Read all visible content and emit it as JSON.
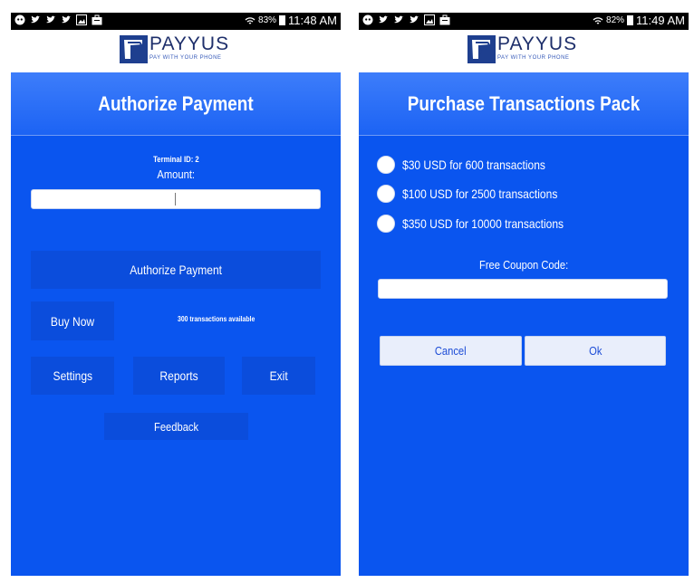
{
  "left_phone": {
    "status": {
      "battery_pct": "83%",
      "time": "11:48 AM"
    },
    "logo": {
      "name": "PAYYUS",
      "tagline": "PAY WITH YOUR PHONE"
    },
    "title": "Authorize Payment",
    "terminal_id": "Terminal ID: 2",
    "amount_label": "Amount:",
    "amount_value": "",
    "authorize_button": "Authorize Payment",
    "buy_now_button": "Buy Now",
    "transactions_available": "300 transactions available",
    "settings_button": "Settings",
    "reports_button": "Reports",
    "exit_button": "Exit",
    "feedback_button": "Feedback"
  },
  "right_phone": {
    "status": {
      "battery_pct": "82%",
      "time": "11:49 AM"
    },
    "logo": {
      "name": "PAYYUS",
      "tagline": "PAY WITH YOUR PHONE"
    },
    "title": "Purchase Transactions Pack",
    "options": [
      {
        "label": "$30 USD for 600 transactions",
        "selected": false
      },
      {
        "label": "$100 USD for 2500 transactions",
        "selected": false
      },
      {
        "label": "$350 USD for 10000 transactions",
        "selected": false
      }
    ],
    "coupon_label": "Free Coupon Code:",
    "coupon_value": "",
    "cancel_button": "Cancel",
    "ok_button": "Ok"
  },
  "colors": {
    "screen_blue": "#0a55ef",
    "button_blue": "#0b4ddc",
    "logo_navy": "#1e2f6b"
  },
  "status_icons": [
    "reddit-icon",
    "twitter-icon",
    "twitter-icon",
    "twitter-icon",
    "image-icon",
    "briefcase-icon"
  ]
}
